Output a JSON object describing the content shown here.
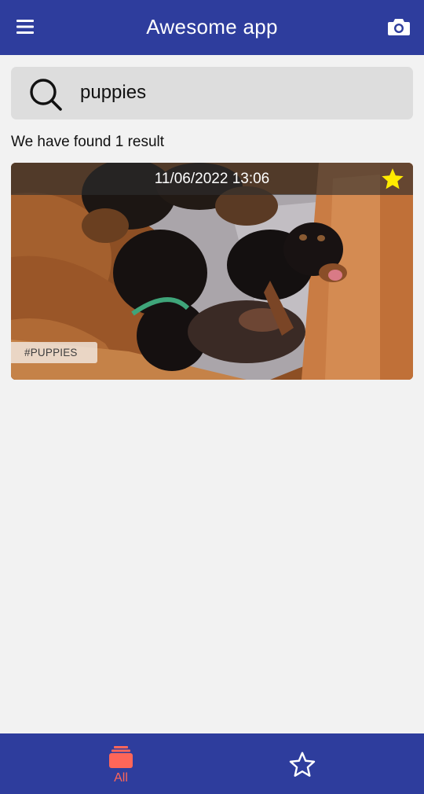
{
  "app_bar": {
    "title": "Awesome app",
    "menu_icon": "menu-icon",
    "camera_icon": "camera-icon",
    "background": "#2e3d9d"
  },
  "search": {
    "value": "puppies",
    "icon": "search-icon"
  },
  "results": {
    "count_text": "We have found 1 result"
  },
  "cards": [
    {
      "date": "11/06/2022 13:06",
      "favorite": true,
      "favorite_icon": "star-filled-icon",
      "favorite_color": "#ffeb00",
      "tag": "#PUPPIES",
      "image": "litter of black-and-tan puppies in a wooden whelping box"
    }
  ],
  "bottom_nav": {
    "items": [
      {
        "label": "All",
        "icon": "stacked-photos-icon",
        "active": true,
        "color": "#ff6659"
      },
      {
        "label": "",
        "icon": "star-outline-icon",
        "active": false,
        "color": "#ffffff"
      }
    ]
  }
}
